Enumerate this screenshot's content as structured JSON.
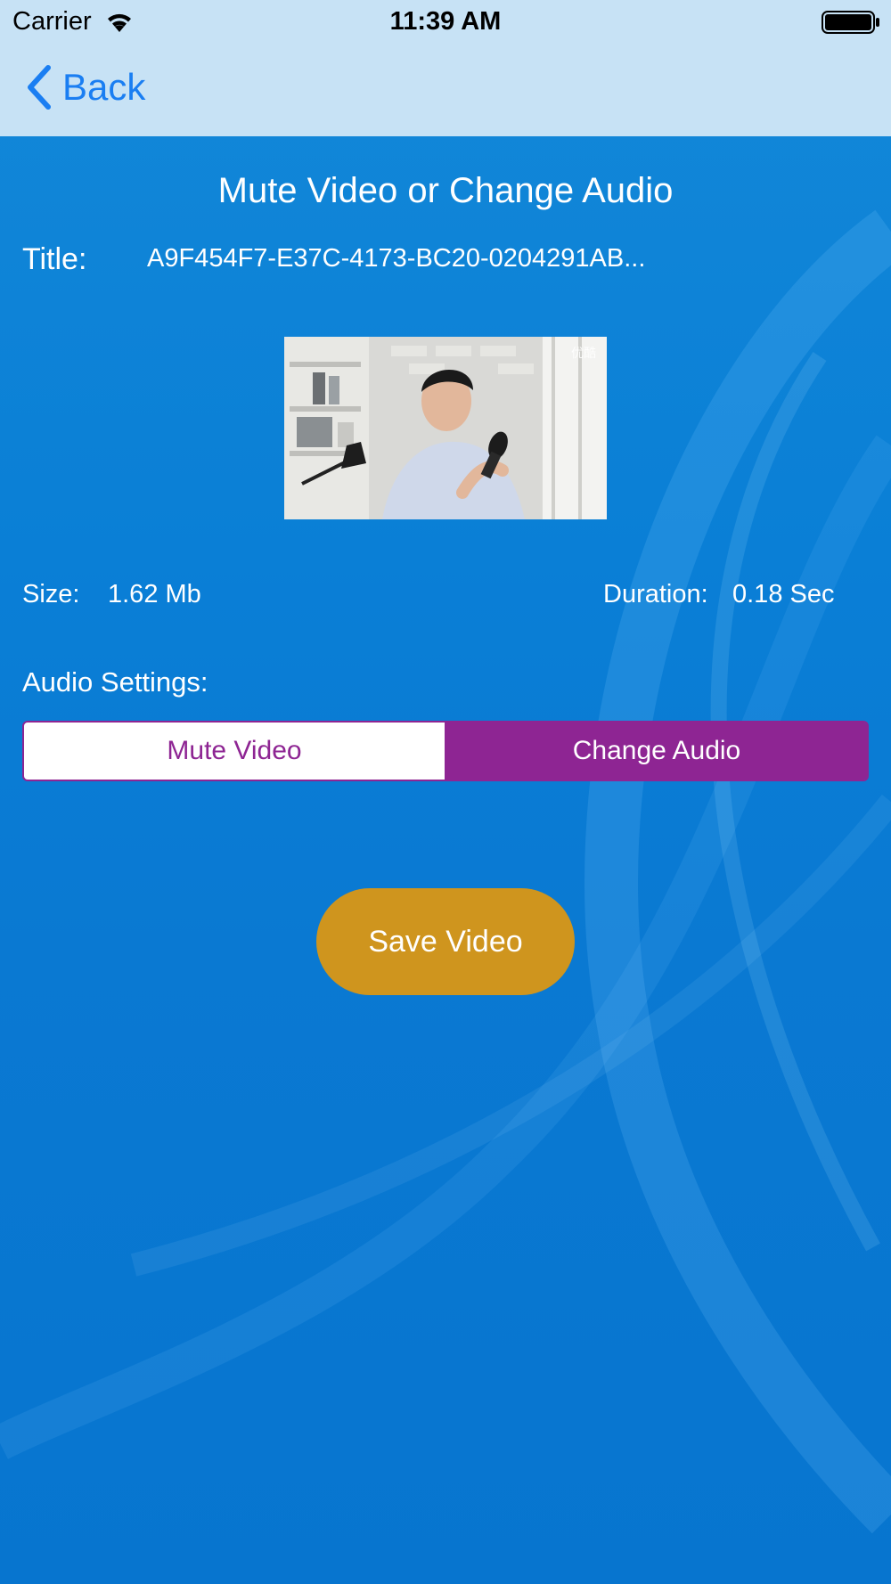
{
  "status_bar": {
    "carrier": "Carrier",
    "time": "11:39 AM",
    "wifi_icon": "wifi-icon",
    "battery_icon": "battery-icon"
  },
  "nav": {
    "back_label": "Back",
    "back_icon": "chevron-left-icon"
  },
  "main": {
    "page_title": "Mute Video or Change Audio",
    "title_label": "Title:",
    "title_value": "A9F454F7-E37C-4173-BC20-0204291AB...",
    "size_label": "Size:",
    "size_value": "1.62 Mb",
    "duration_label": "Duration:",
    "duration_value": "0.18 Sec",
    "audio_settings_label": "Audio Settings:",
    "video_watermark": "优酷"
  },
  "audio_segmented": {
    "options": [
      "Mute Video",
      "Change Audio"
    ],
    "selected": "Change Audio"
  },
  "actions": {
    "save_label": "Save Video"
  },
  "colors": {
    "accent_purple": "#8e2593",
    "save_button": "#cf951e",
    "background_blue": "#0a7fd6",
    "nav_bar": "#c7e2f5",
    "link_blue": "#1a7ef2"
  }
}
